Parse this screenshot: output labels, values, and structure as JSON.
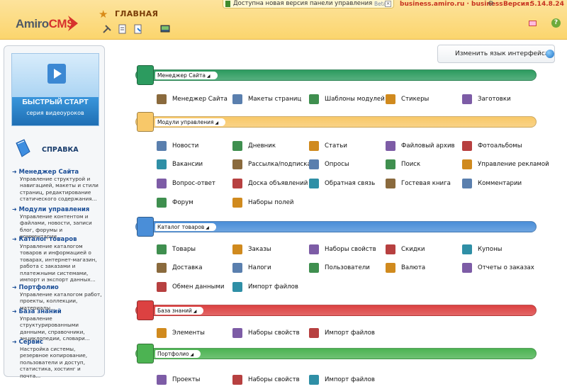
{
  "header": {
    "logo_main": "Amiro",
    "logo_cms": "CMS",
    "home_title": "ГЛАВНАЯ",
    "notification": "Доступна новая версия панели управления",
    "notification_beta": "Beta",
    "domain": "business.amiro.ru · business",
    "version_label": "Версия:",
    "version": "5.14.8.24"
  },
  "sidebar": {
    "quickstart_title": "БЫСТРЫЙ СТАРТ",
    "quickstart_sub": "серия видеоуроков",
    "help_title": "СПРАВКА",
    "sections": [
      {
        "title": "Менеджер Сайта",
        "desc": "Управление структурой и навигацией, макеты и стили страниц, редактирование статического содержания..."
      },
      {
        "title": "Модули управления",
        "desc": "Управление контентом и файлами, новости, записи блог, форумы и комментарии..."
      },
      {
        "title": "Каталог товаров",
        "desc": "Управление каталогом товаров и информацией о товарах, интернет-магазин, работа с заказами и платежными системами, импорт и экспорт данных..."
      },
      {
        "title": "Портфолио",
        "desc": "Управление каталогом работ, проекты, коллекции, материалы..."
      },
      {
        "title": "База знаний",
        "desc": "Управление структурированными данными, справочники, энциклопедии, словари..."
      },
      {
        "title": "Сервис",
        "desc": "Настройка системы, резервное копирование, пользователи и доступ, статистика, хостинг и почта..."
      }
    ]
  },
  "main": {
    "lang_button": "Изменить язык интерфейса",
    "sections": [
      {
        "label": "Менеджер Сайта",
        "color": "#2c9b5f",
        "items": [
          "Менеджер Сайта",
          "Макеты страниц",
          "Шаблоны модулей",
          "Стикеры",
          "Заготовки"
        ]
      },
      {
        "label": "Модули управления",
        "color": "#f8c869",
        "items": [
          "Новости",
          "Дневник",
          "Статьи",
          "Файловый архив",
          "Фотоальбомы",
          "Вакансии",
          "Рассылка/подписка",
          "Опросы",
          "Поиск",
          "Управление рекламой",
          "Вопрос-ответ",
          "Доска объявлений",
          "Обратная связь",
          "Гостевая книга",
          "Комментарии",
          "Форум",
          "Наборы полей"
        ]
      },
      {
        "label": "Каталог товаров",
        "color": "#4a8ed8",
        "items": [
          "Товары",
          "Заказы",
          "Наборы свойств",
          "Скидки",
          "Купоны",
          "Доставка",
          "Налоги",
          "Пользователи",
          "Валюта",
          "Отчеты о заказах",
          "Обмен данными",
          "Импорт файлов"
        ]
      },
      {
        "label": "База знаний",
        "color": "#dc4141",
        "items": [
          "Элементы",
          "Наборы свойств",
          "Импорт файлов"
        ]
      },
      {
        "label": "Портфолио",
        "color": "#4cb352",
        "items": [
          "Проекты",
          "Наборы свойств",
          "Импорт файлов"
        ]
      }
    ]
  }
}
